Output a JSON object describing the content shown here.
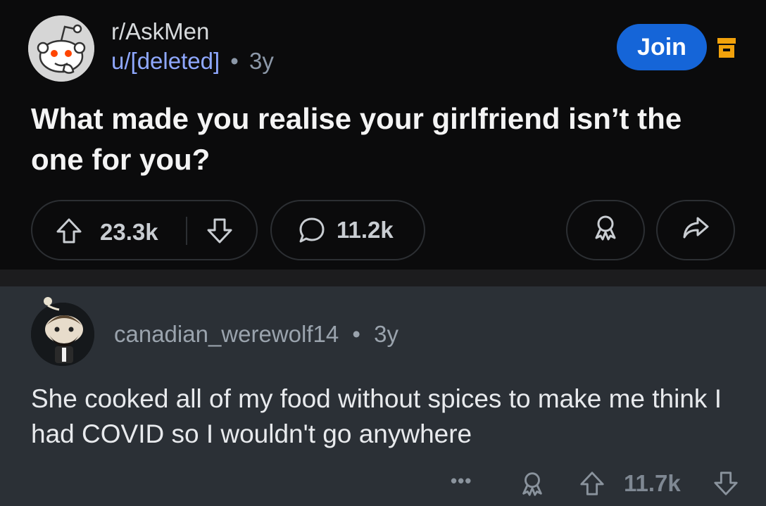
{
  "post": {
    "subreddit": "r/AskMen",
    "user": "u/[deleted]",
    "dot": "•",
    "age": "3y",
    "join_label": "Join",
    "title": "What made you realise your girlfriend isn’t the one for you?",
    "score": "23.3k",
    "comments": "11.2k"
  },
  "comment": {
    "user": "canadian_werewolf14",
    "dot": "•",
    "age": "3y",
    "body": "She cooked all of my food without spices to make me think I had COVID so I wouldn't go anywhere",
    "score": "11.7k",
    "more_label": "•••"
  },
  "colors": {
    "join_bg": "#1565d8",
    "archive_icon": "#f2a20c",
    "user_link": "#8fa8ff"
  },
  "icons": {
    "archive": "archive-icon",
    "upvote": "upvote-arrow-icon",
    "downvote": "downvote-arrow-icon",
    "comment": "comment-bubble-icon",
    "award": "award-icon",
    "share": "share-arrow-icon",
    "more": "more-options-icon"
  }
}
